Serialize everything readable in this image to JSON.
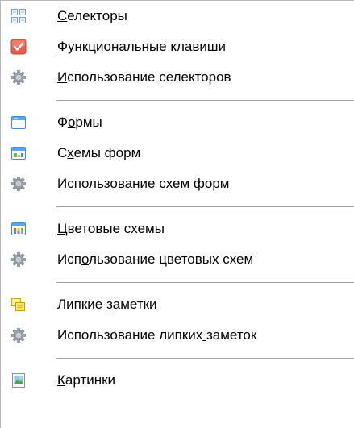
{
  "menu": {
    "groups": [
      {
        "items": [
          {
            "label": "Селекторы",
            "underline": 0,
            "icon": "selectors-grid-icon"
          },
          {
            "label": "Функциональные клавиши",
            "underline": 0,
            "icon": "function-keys-check-icon"
          },
          {
            "label": "Использование селекторов",
            "underline": 0,
            "icon": "gear-icon"
          }
        ]
      },
      {
        "items": [
          {
            "label": "Формы",
            "underline": 1,
            "icon": "form-window-icon"
          },
          {
            "label": "Схемы форм",
            "underline": 1,
            "icon": "form-scheme-icon"
          },
          {
            "label": "Использование схем форм",
            "underline": 2,
            "icon": "gear-icon"
          }
        ]
      },
      {
        "items": [
          {
            "label": "Цветовые схемы",
            "underline": 0,
            "icon": "color-scheme-icon"
          },
          {
            "label": "Использование цветовых схем",
            "underline": 3,
            "icon": "gear-icon"
          }
        ]
      },
      {
        "items": [
          {
            "label": "Липкие заметки",
            "underline": 7,
            "icon": "sticky-notes-icon"
          },
          {
            "label": "Использование липких заметок",
            "underline": 20,
            "icon": "gear-icon"
          }
        ]
      },
      {
        "items": [
          {
            "label": "Картинки",
            "underline": 0,
            "icon": "picture-icon"
          }
        ]
      }
    ]
  }
}
